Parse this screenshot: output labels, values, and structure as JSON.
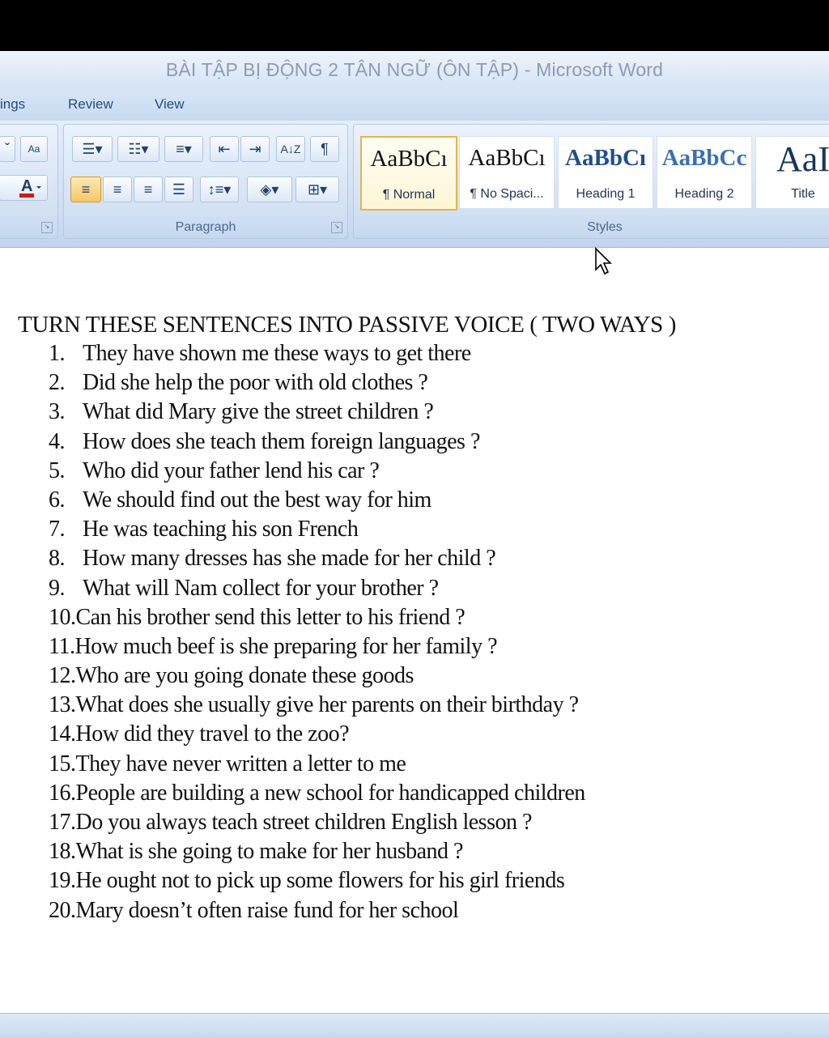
{
  "window": {
    "title": "BÀI TẬP BỊ ĐỘNG 2 TÂN NGỮ (ÔN TẬP) - Microsoft Word"
  },
  "tabs": [
    "ings",
    "Review",
    "View"
  ],
  "ribbon": {
    "paragraph_label": "Paragraph",
    "styles_label": "Styles",
    "styles": [
      {
        "sample": "AaBbCı",
        "name": "¶ Normal",
        "selected": true
      },
      {
        "sample": "AaBbCı",
        "name": "¶ No Spaci..."
      },
      {
        "sample": "AaBbCı",
        "name": "Heading 1"
      },
      {
        "sample": "AaBbCc",
        "name": "Heading 2"
      },
      {
        "sample": "AaI",
        "name": "Title"
      }
    ],
    "font_color": "#d01818",
    "highlight_color": "#f6c865"
  },
  "document": {
    "heading": "TURN THESE SENTENCES INTO PASSIVE VOICE ( TWO WAYS )",
    "items": [
      {
        "num": "1.",
        "text": "They have shown me these ways to get there"
      },
      {
        "num": "2.",
        "text": "Did she help the poor with old clothes ?"
      },
      {
        "num": "3.",
        "text": "What did Mary give the street children ?"
      },
      {
        "num": "4.",
        "text": "How does she teach them foreign languages ?"
      },
      {
        "num": "5.",
        "text": "Who did your father lend his car ?"
      },
      {
        "num": "6.",
        "text": "We should find out the best way for him"
      },
      {
        "num": "7.",
        "text": "He was teaching his son French"
      },
      {
        "num": "8.",
        "text": "How many dresses has she made for her child ?"
      },
      {
        "num": "9.",
        "text": "What will Nam collect for your brother ?"
      },
      {
        "num": "10.",
        "text": "Can his brother send this letter to his friend ?"
      },
      {
        "num": "11.",
        "text": "How much beef is she preparing for her family ?"
      },
      {
        "num": "12.",
        "text": "Who are you going donate these goods"
      },
      {
        "num": "13.",
        "text": "What does she usually give her parents on their birthday ?"
      },
      {
        "num": "14.",
        "text": "How  did they travel to the zoo?"
      },
      {
        "num": "15.",
        "text": "They have never written a letter to me"
      },
      {
        "num": "16.",
        "text": "People are building a new school for handicapped children"
      },
      {
        "num": "17.",
        "text": "Do you always teach street children English lesson ?"
      },
      {
        "num": "18.",
        "text": "What is she going to make for her husband ?"
      },
      {
        "num": "19.",
        "text": "He ought not to pick up some flowers for his girl friends"
      },
      {
        "num": "20.",
        "text": "Mary doesn’t often raise fund for her school"
      }
    ]
  }
}
